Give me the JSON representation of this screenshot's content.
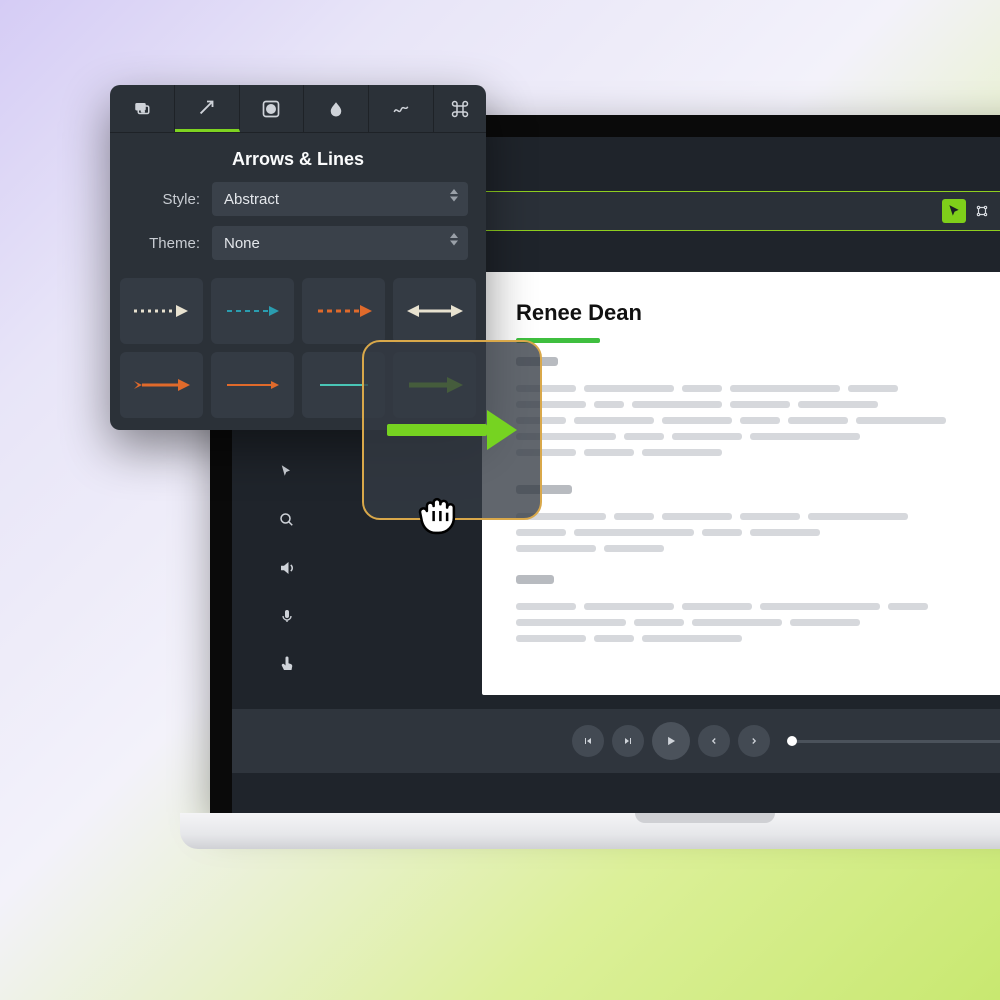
{
  "panel": {
    "title": "Arrows & Lines",
    "style_label": "Style:",
    "style_value": "Abstract",
    "theme_label": "Theme:",
    "theme_value": "None"
  },
  "document": {
    "title": "Renee Dean"
  },
  "colors": {
    "accent_green": "#7ed321",
    "orange": "#e06a2b",
    "teal": "#2a9db0",
    "cream": "#e8e2d0"
  }
}
